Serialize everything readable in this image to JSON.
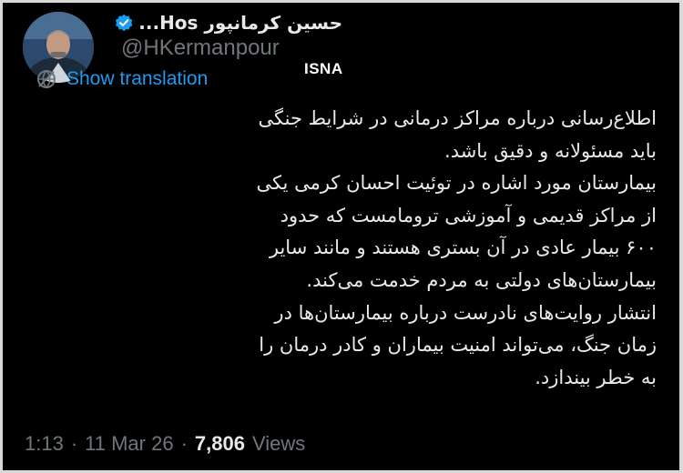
{
  "header": {
    "display_name": "حسین کرمانپور Hos...",
    "handle": "@HKermanpour",
    "verified": true,
    "accent_color": "#1d9bf0"
  },
  "watermark": "ISNA",
  "translate": {
    "label": "Show translation",
    "icon": "translate-icon"
  },
  "tweet": {
    "lines": [
      "اطلاع‌رسانی درباره مراکز درمانی در شرایط جنگی",
      "باید مسئولانه و دقیق باشد.",
      "بیمارستان مورد اشاره در توئیت احسان کرمی یکی",
      "از مراکز قدیمی و آموزشی ترومامست که حدود",
      "۶۰۰ بیمار عادی در آن بستری هستند و مانند سایر",
      "بیمارستان‌های دولتی به مردم خدمت می‌کند.",
      "انتشار روایت‌های نادرست درباره بیمارستان‌ها در",
      "زمان جنگ، می‌تواند امنیت بیماران و کادر درمان را",
      "به خطر بیندازد."
    ]
  },
  "meta": {
    "time": "1:13",
    "separator": "·",
    "date": "11 Mar 26",
    "views_count": "7,806",
    "views_label": "Views"
  }
}
